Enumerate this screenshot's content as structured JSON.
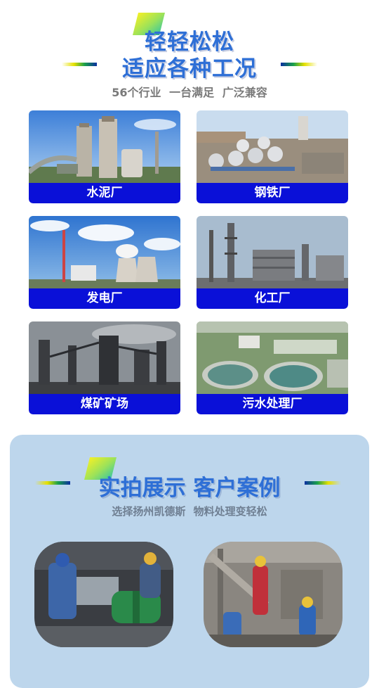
{
  "section1": {
    "title_line1": "轻轻松松",
    "title_line2": "适应各种工况",
    "subtitle": "56个行业  一台满足  广泛兼容",
    "industries": [
      {
        "label": "水泥厂",
        "icon": "cement-plant-photo"
      },
      {
        "label": "钢铁厂",
        "icon": "steel-plant-photo"
      },
      {
        "label": "发电厂",
        "icon": "power-plant-photo"
      },
      {
        "label": "化工厂",
        "icon": "chemical-plant-photo"
      },
      {
        "label": "煤矿矿场",
        "icon": "coal-mine-photo"
      },
      {
        "label": "污水处理厂",
        "icon": "sewage-plant-photo"
      }
    ]
  },
  "section2": {
    "title": "实拍展示 客户案例",
    "subtitle": "选择扬州凯德斯  物料处理变轻松",
    "cases": [
      {
        "icon": "workers-installing-equipment-photo"
      },
      {
        "icon": "workers-on-site-photo"
      }
    ]
  },
  "colors": {
    "accent_blue": "#2e6fd6",
    "label_blue": "#0a10d8",
    "panel_bg": "#bdd6ec"
  }
}
